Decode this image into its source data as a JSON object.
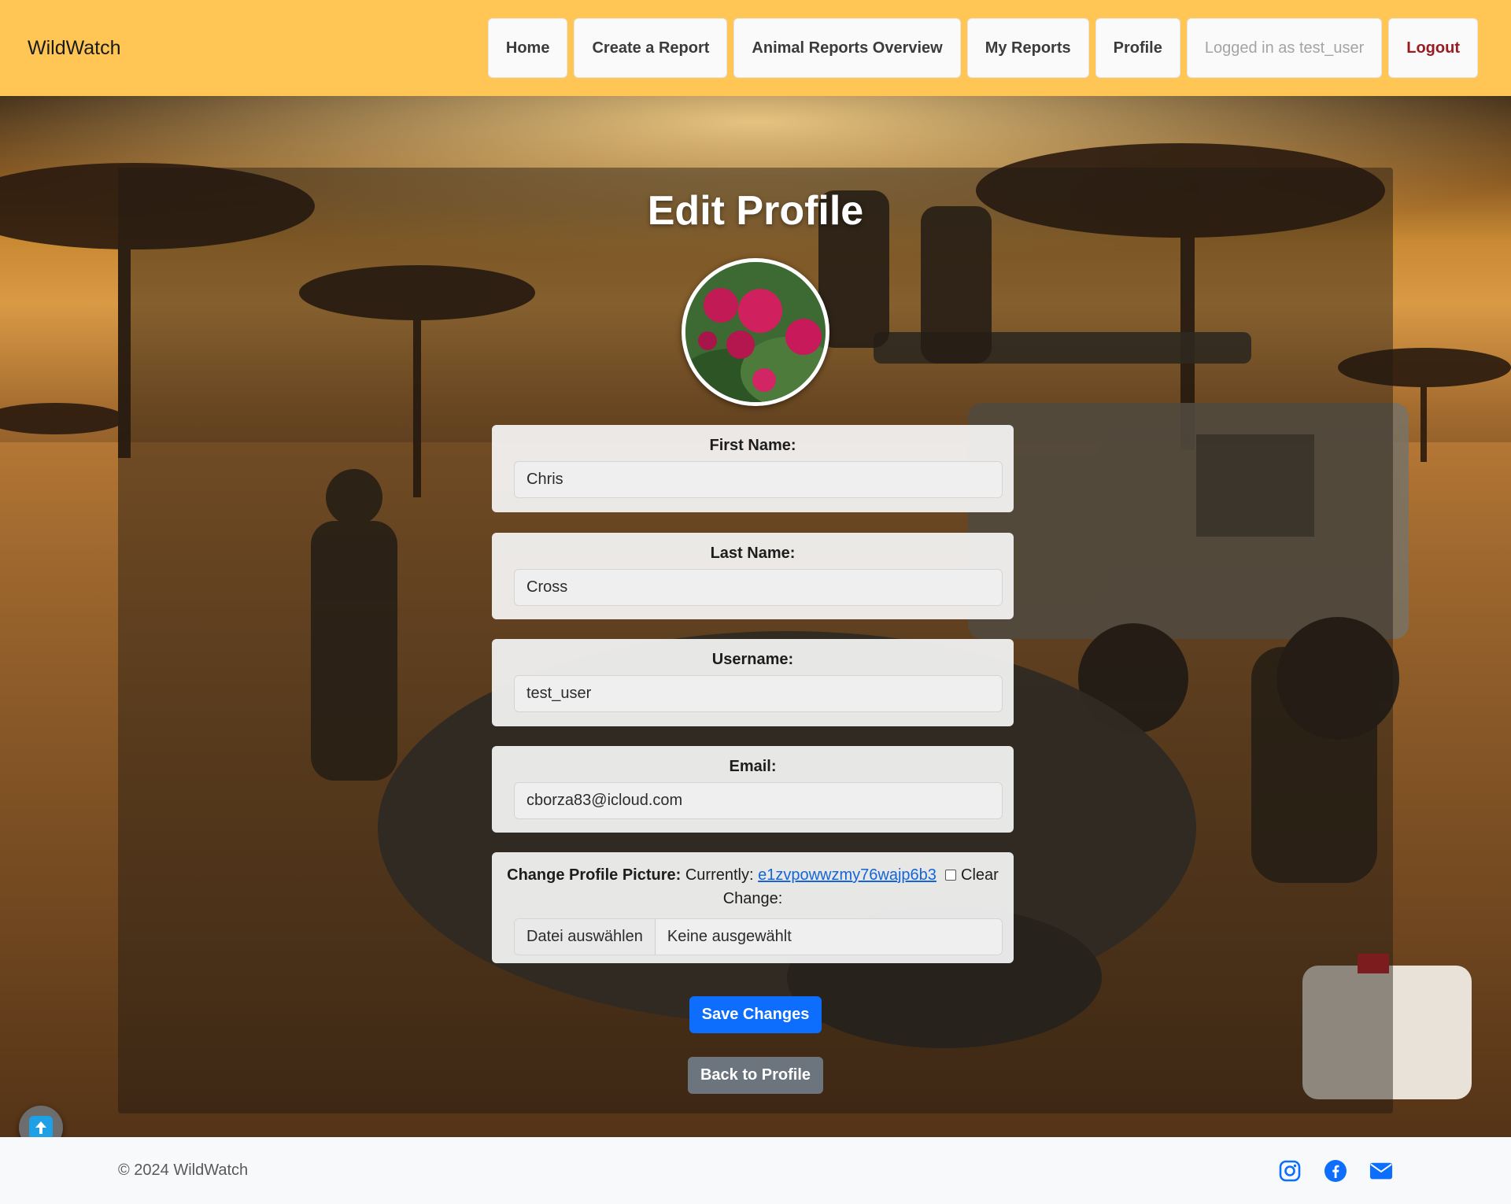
{
  "brand": "WildWatch",
  "nav": {
    "home": "Home",
    "create_report": "Create a Report",
    "overview": "Animal Reports Overview",
    "my_reports": "My Reports",
    "profile": "Profile",
    "logged_in": "Logged in as test_user",
    "logout": "Logout"
  },
  "page": {
    "title": "Edit Profile"
  },
  "form": {
    "first_name": {
      "label": "First Name:",
      "value": "Chris"
    },
    "last_name": {
      "label": "Last Name:",
      "value": "Cross"
    },
    "username": {
      "label": "Username:",
      "value": "test_user"
    },
    "email": {
      "label": "Email:",
      "value": "cborza83@icloud.com"
    },
    "picture": {
      "label": "Change Profile Picture:",
      "currently_label": "Currently:",
      "current_file": "e1zvpowwzmy76wajp6b3",
      "clear_label": "Clear",
      "change_label": "Change:",
      "choose_button": "Datei auswählen",
      "no_file": "Keine ausgewählt"
    },
    "save_button": "Save Changes",
    "back_button": "Back to Profile"
  },
  "footer": {
    "copyright": "© 2024 WildWatch"
  },
  "icons": {
    "scroll_top": "arrow-up-icon",
    "instagram": "instagram-icon",
    "facebook": "facebook-icon",
    "email": "mail-icon"
  },
  "colors": {
    "navbar": "#ffc655",
    "primary": "#0d6efd",
    "secondary": "#6c757d",
    "logout": "#9b1b22",
    "footer": "#f8f9fa"
  }
}
